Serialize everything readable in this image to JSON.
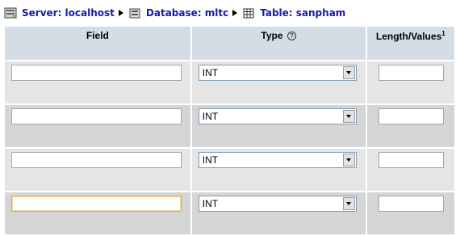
{
  "breadcrumb": {
    "server": "Server: localhost",
    "database": "Database: mltc",
    "table": "Table: sanpham"
  },
  "columns": {
    "field": "Field",
    "type": "Type",
    "length": "Length/Values",
    "length_sup": "1"
  },
  "rows": [
    {
      "field": "",
      "type": "INT",
      "length": ""
    },
    {
      "field": "",
      "type": "INT",
      "length": ""
    },
    {
      "field": "",
      "type": "INT",
      "length": ""
    },
    {
      "field": "",
      "type": "INT",
      "length": ""
    }
  ],
  "icons": {
    "server": "server-icon",
    "database": "database-icon",
    "table": "table-icon",
    "help": "help-icon"
  }
}
